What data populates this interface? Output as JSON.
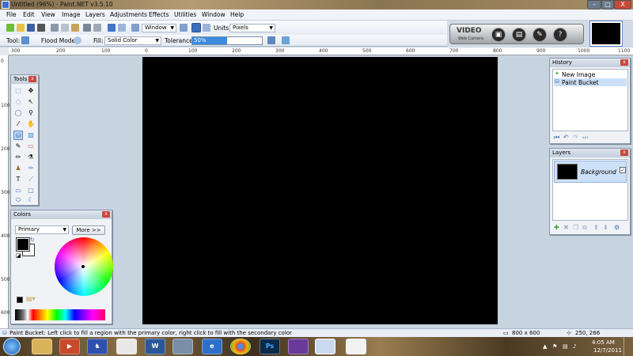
{
  "window": {
    "title": "Untitled (96%) - Paint.NET v3.5.10",
    "min": "–",
    "max": "□",
    "close": "X"
  },
  "menu": [
    "File",
    "Edit",
    "View",
    "Image",
    "Layers",
    "Adjustments",
    "Effects",
    "Utilities",
    "Window",
    "Help"
  ],
  "toolbar": {
    "zoom_mode": "Window",
    "units_label": "Units:",
    "units_value": "Pixels",
    "tool_label": "Tool:",
    "flood_label": "Flood Mode:",
    "fill_label": "Fill:",
    "fill_value": "Solid Color",
    "tolerance_label": "Tolerance:",
    "tolerance_value": "50%",
    "tolerance_level": 0.5
  },
  "camera_widget": {
    "title": "VIDEO",
    "subtitle": "Web Camera"
  },
  "ruler": {
    "top": [
      "300",
      "200",
      "100",
      "0",
      "100",
      "200",
      "300",
      "400",
      "500",
      "600",
      "700",
      "800",
      "900",
      "1000",
      "1100"
    ],
    "left": [
      "0",
      "100",
      "200",
      "300",
      "400",
      "500",
      "600",
      "700"
    ]
  },
  "tools_panel": {
    "title": "Tools",
    "close": "x"
  },
  "colors_panel": {
    "title": "Colors",
    "mode": "Primary",
    "more": "More >>",
    "close": "x"
  },
  "history_panel": {
    "title": "History",
    "items": [
      "New Image",
      "Paint Bucket"
    ],
    "close": "x"
  },
  "layers_panel": {
    "title": "Layers",
    "layer_name": "Background",
    "check": "✓",
    "close": "x"
  },
  "status": {
    "hint": "Paint Bucket: Left click to fill a region with the primary color, right click to fill with the secondary color",
    "size": "800 x 600",
    "coords": "250, 266"
  },
  "taskbar": {
    "time": "4:05 AM",
    "date": "12/7/2011",
    "apps": [
      "W",
      "Ps"
    ]
  }
}
